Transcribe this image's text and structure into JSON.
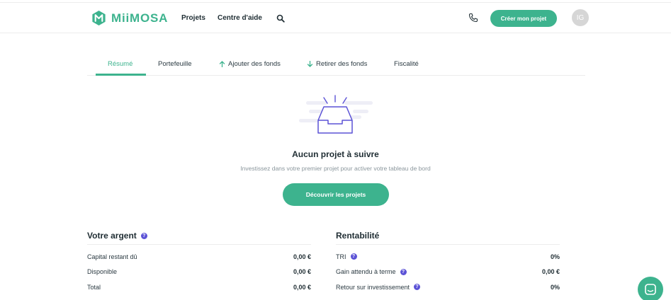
{
  "brand": {
    "name": "MiiMOSA",
    "color": "#3db38e"
  },
  "nav": {
    "links": [
      "Projets",
      "Centre d'aide"
    ],
    "search_icon": "search-icon",
    "phone_icon": "phone-icon",
    "cta_label": "Créer mon projet",
    "avatar_initials": "IG"
  },
  "tabs": [
    {
      "label": "Résumé",
      "active": true
    },
    {
      "label": "Portefeuille",
      "active": false
    },
    {
      "label": "Ajouter des fonds",
      "icon": "arrow-up-icon",
      "active": false
    },
    {
      "label": "Retirer des fonds",
      "icon": "arrow-down-icon",
      "active": false
    },
    {
      "label": "Fiscalité",
      "active": false
    }
  ],
  "empty_state": {
    "illustration": "empty-inbox-icon",
    "title": "Aucun projet à suivre",
    "subtitle": "Investissez dans votre premier projet pour activer votre tableau de bord",
    "button_label": "Découvrir les projets"
  },
  "money": {
    "title": "Votre argent",
    "rows": [
      {
        "label": "Capital restant dû",
        "value": "0,00 €"
      },
      {
        "label": "Disponible",
        "value": "0,00 €"
      },
      {
        "label": "Total",
        "value": "0,00 €"
      }
    ]
  },
  "returns": {
    "title": "Rentabilité",
    "rows": [
      {
        "label": "TRI",
        "value": "0%",
        "help": true
      },
      {
        "label": "Gain attendu à terme",
        "value": "0,00 €",
        "help": true
      },
      {
        "label": "Retour sur investissement",
        "value": "0%",
        "help": true
      }
    ]
  },
  "help_glyph": "?",
  "chat_icon": "chat-icon",
  "colors": {
    "accent": "#3db38e",
    "help": "#5b52d6",
    "illustration": "#5b52d6"
  }
}
